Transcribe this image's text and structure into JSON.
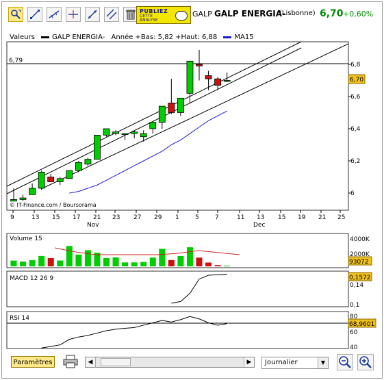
{
  "toolbar": {
    "tools": [
      "zoom-tool-icon",
      "line-tool-icon",
      "trend-line-icon",
      "horizontal-line-icon",
      "fibonacci-icon",
      "parallel-lines-icon",
      "delete-icon"
    ],
    "ad_line1": "PUBLIEZ",
    "ad_line2": "CETTE",
    "ad_line3": "ANALYSE"
  },
  "quote": {
    "symbol": "GALP",
    "name": "GALP ENERGIA-",
    "exchange": "(Lisbonne)",
    "price": "6,70",
    "change": "+0,60%",
    "change_color": "#008a00"
  },
  "legend": {
    "valeurs": "Valeurs",
    "series": "GALP ENERGIA-",
    "stats": "Année +Bas: 5,82 +Haut: 6,88",
    "ma": "MA15",
    "ma_color": "#1a1acc"
  },
  "price_panel": {
    "hline_label": "6,79",
    "last_price_tag": "6,70",
    "credit": "© IT-Finance.com / Boursorama",
    "y_ticks": [
      "6,8",
      "6,6",
      "6,4",
      "6,2",
      "6"
    ],
    "x_ticks": [
      "9",
      "13",
      "15",
      "17",
      "21",
      "23",
      "27",
      "29",
      "1",
      "5",
      "7",
      "11",
      "13",
      "15",
      "19",
      "21",
      "25"
    ],
    "months": [
      "Nov",
      "Dec"
    ]
  },
  "volume_panel": {
    "label": "Volume 15",
    "y_ticks": [
      "4000K",
      "2000K"
    ],
    "last_value": "93072"
  },
  "macd_panel": {
    "label": "MACD 12 26 9",
    "y_ticks": [
      "0,14",
      "0,1"
    ],
    "last_value": "0,1572"
  },
  "rsi_panel": {
    "label": "RSI 14",
    "y_ticks": [
      "80",
      "60",
      "40"
    ],
    "last_value": "68,9601"
  },
  "bottom": {
    "params_label": "Paramètres",
    "period_value": "Journalier"
  },
  "chart_data": {
    "type": "candlestick",
    "series": [
      {
        "name": "GALP ENERGIA-",
        "open": [
          5.95,
          5.96,
          5.99,
          6.03,
          6.1,
          6.07,
          6.09,
          6.14,
          6.18,
          6.21,
          6.36,
          6.37,
          6.37,
          6.37,
          6.35,
          6.4,
          6.44,
          6.56,
          6.5,
          6.62,
          6.8,
          6.73,
          6.71,
          6.7
        ],
        "high": [
          6.03,
          5.99,
          6.06,
          6.14,
          6.12,
          6.1,
          6.14,
          6.2,
          6.22,
          6.33,
          6.4,
          6.39,
          6.37,
          6.39,
          6.39,
          6.43,
          6.5,
          6.71,
          6.58,
          6.69,
          6.89,
          6.76,
          6.72,
          6.75
        ],
        "low": [
          5.95,
          5.95,
          5.99,
          6.02,
          6.07,
          6.05,
          6.09,
          6.13,
          6.17,
          6.21,
          6.35,
          6.36,
          6.33,
          6.34,
          6.32,
          6.37,
          6.4,
          6.49,
          6.48,
          6.56,
          6.7,
          6.64,
          6.64,
          6.69
        ],
        "close": [
          5.96,
          5.97,
          6.03,
          6.13,
          6.07,
          6.09,
          6.14,
          6.19,
          6.21,
          6.36,
          6.4,
          6.38,
          6.37,
          6.38,
          6.37,
          6.44,
          6.54,
          6.5,
          6.59,
          6.82,
          6.79,
          6.71,
          6.67,
          6.7
        ]
      }
    ],
    "ma15": [
      null,
      null,
      null,
      null,
      null,
      null,
      6.0,
      6.01,
      6.03,
      6.05,
      6.08,
      6.11,
      6.14,
      6.17,
      6.2,
      6.23,
      6.26,
      6.3,
      6.33,
      6.37,
      6.41,
      6.45,
      6.48,
      6.51
    ],
    "volume_k": [
      820,
      680,
      870,
      1480,
      1180,
      830,
      2900,
      1680,
      2310,
      1950,
      1180,
      1280,
      560,
      560,
      620,
      1250,
      2500,
      900,
      1480,
      2720,
      1250,
      540,
      170,
      93
    ],
    "macd": [
      null,
      null,
      null,
      null,
      null,
      null,
      null,
      null,
      null,
      null,
      null,
      null,
      null,
      null,
      null,
      null,
      null,
      0.104,
      0.107,
      0.122,
      0.148,
      0.155,
      0.156,
      0.157
    ],
    "rsi": [
      null,
      null,
      null,
      38,
      40,
      42,
      49,
      52,
      54,
      57,
      60,
      62,
      63,
      64,
      67,
      70,
      73,
      71,
      74,
      78,
      75,
      70,
      67,
      69
    ],
    "xlabel": "",
    "ylabel": "",
    "ylim": [
      5.9,
      6.92
    ],
    "grid": false,
    "legend_position": "top-left"
  }
}
